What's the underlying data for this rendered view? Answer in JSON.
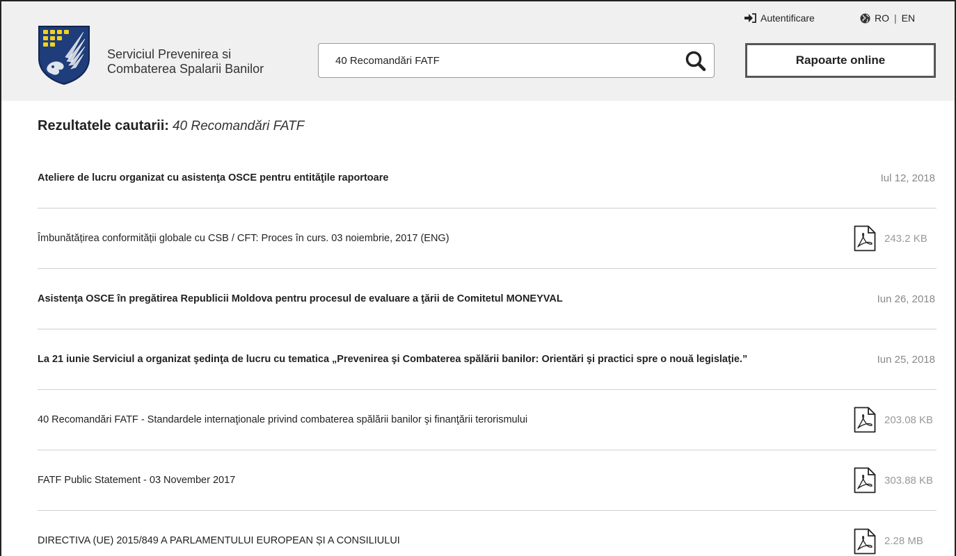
{
  "header": {
    "org_line1": "Serviciul Prevenirea si",
    "org_line2": "Combaterea Spalarii Banilor",
    "search_value": "40 Recomandări FATF",
    "online_button": "Rapoarte online",
    "login_label": "Autentificare",
    "lang_ro": "RO",
    "lang_en": "EN"
  },
  "results": {
    "heading": "Rezultatele cautarii:",
    "query": "40 Recomandări FATF",
    "items": [
      {
        "title": "Ateliere de lucru organizat cu asistenţa OSCE pentru entităţile raportoare",
        "date": "Iul 12, 2018"
      },
      {
        "title": "Îmbunătățirea conformității globale cu CSB / CFT: Proces în curs. 03 noiembrie, 2017 (ENG)",
        "size": "243.2 KB"
      },
      {
        "title": "Asistenţa OSCE în pregătirea Republicii Moldova pentru procesul de evaluare a ţării de Comitetul MONEYVAL",
        "date": "Iun 26, 2018"
      },
      {
        "title": "La 21 iunie Serviciul a organizat şedinţa de lucru cu tematica „Prevenirea şi Combaterea spălării banilor: Orientări şi practici spre o nouă legislaţie.”",
        "date": "Iun 25, 2018"
      },
      {
        "title": "40 Recomandări FATF - Standardele internaţionale privind combaterea spălării banilor şi finanţării terorismului",
        "size": "203.08 KB"
      },
      {
        "title": "FATF Public Statement - 03 November 2017",
        "size": "303.88 KB"
      },
      {
        "title": "DIRECTIVA (UE) 2015/849 A PARLAMENTULUI EUROPEAN ȘI A CONSILIULUI",
        "size": "2.28 MB"
      }
    ]
  },
  "colors": {
    "header_bg": "#f0f0f0",
    "logo_blue": "#1f3d7a",
    "logo_gold": "#f2d21b",
    "muted_text": "#888888",
    "divider": "#cfcfcf"
  },
  "icons": {
    "search": "search-icon",
    "login": "login-arrow-icon",
    "language": "globe-icon",
    "document": "pdf-file-icon",
    "logo": "emblem-logo"
  }
}
